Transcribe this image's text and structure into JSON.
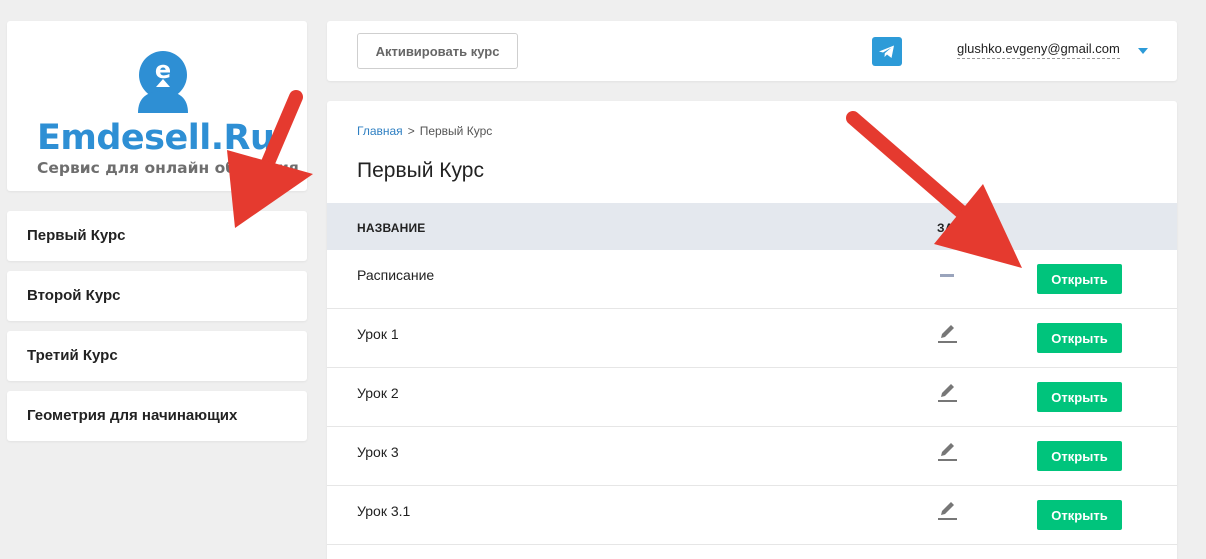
{
  "logo": {
    "text": "Emdesell.Ru",
    "subtitle": "Сервис для онлайн обучения",
    "avatar_letter": "e"
  },
  "sidebar": {
    "items": [
      {
        "label": "Первый Курс"
      },
      {
        "label": "Второй Курс"
      },
      {
        "label": "Третий Курс"
      },
      {
        "label": "Геометрия для начинающих"
      }
    ]
  },
  "topbar": {
    "activate_label": "Активировать курс",
    "telegram_icon": "telegram-icon",
    "user_email": "glushko.evgeny@gmail.com"
  },
  "breadcrumb": {
    "home": "Главная",
    "separator": ">",
    "current": "Первый Курс"
  },
  "page": {
    "title": "Первый Курс"
  },
  "table": {
    "columns": [
      "НАЗВАНИЕ",
      "ЗАД"
    ],
    "rows": [
      {
        "name": "Расписание",
        "icon": "dash-icon",
        "button": "Открыть"
      },
      {
        "name": "Урок 1",
        "icon": "pencil-icon",
        "button": "Открыть"
      },
      {
        "name": "Урок 2",
        "icon": "pencil-icon",
        "button": "Открыть"
      },
      {
        "name": "Урок 3",
        "icon": "pencil-icon",
        "button": "Открыть"
      },
      {
        "name": "Урок 3.1",
        "icon": "pencil-icon",
        "button": "Открыть"
      }
    ]
  },
  "colors": {
    "brand_blue": "#2e8fd4",
    "open_green": "#00c47c",
    "arrow_red": "#e53a2f",
    "header_bg": "#e4e8ee"
  }
}
